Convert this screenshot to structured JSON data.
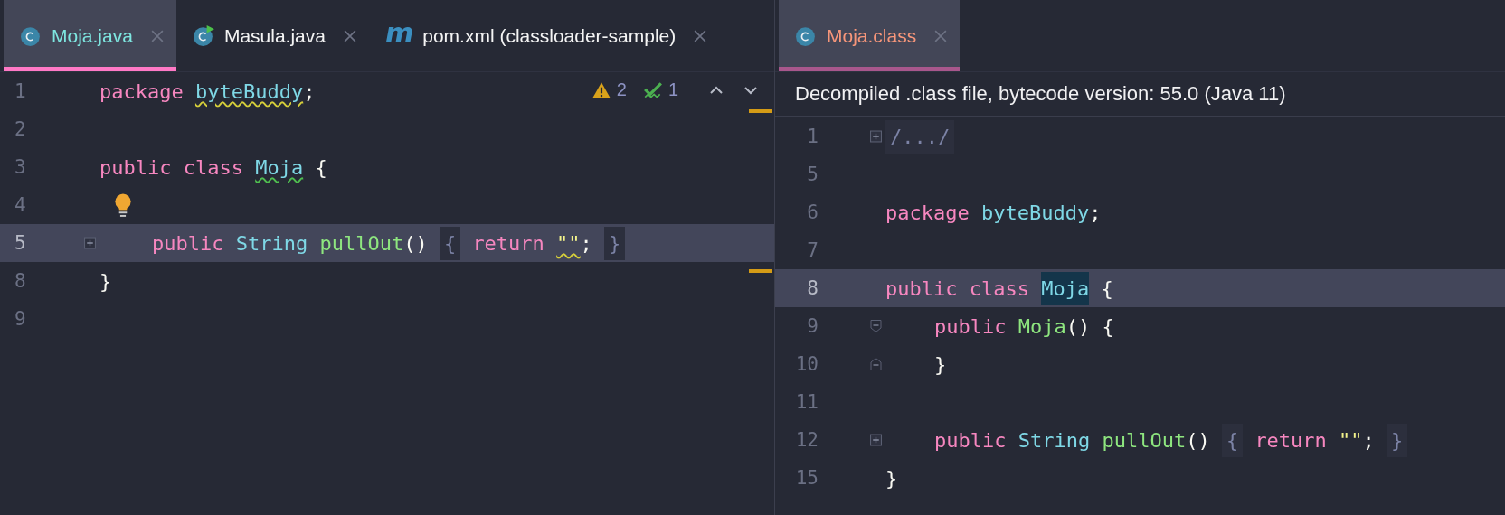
{
  "panes": [
    {
      "focused": true,
      "tabs": [
        {
          "label": "Moja.java",
          "kind": "class",
          "color": "#7ee6e0",
          "selected": true
        },
        {
          "label": "Masula.java",
          "kind": "runnable",
          "color": "#f4f4f4",
          "selected": false
        },
        {
          "label": "pom.xml (classloader-sample)",
          "kind": "maven",
          "icon_glyph": "m",
          "color": "#f4f4f4",
          "selected": false
        }
      ],
      "inspections": {
        "warnings": "2",
        "weak_warnings": "1"
      },
      "lines": [
        {
          "number": "1",
          "current": false,
          "kind": "plain",
          "bulb": false,
          "indented": false,
          "words": [
            [
              {
                "text": "package",
                "kind": "keyword"
              }
            ],
            [
              {
                "text": "byteBuddy",
                "kind": "type",
                "warning": true
              },
              {
                "text": ";",
                "kind": "plain"
              }
            ]
          ]
        },
        {
          "number": "2",
          "current": false,
          "kind": "plain",
          "bulb": false
        },
        {
          "number": "3",
          "current": false,
          "kind": "plain",
          "bulb": false,
          "indented": false,
          "words": [
            [
              {
                "text": "public",
                "kind": "keyword"
              }
            ],
            [
              {
                "text": "class",
                "kind": "keyword"
              }
            ],
            [
              {
                "text": "Moja",
                "kind": "type",
                "weak_warning": true
              }
            ],
            [
              {
                "text": "{",
                "kind": "plain"
              }
            ]
          ]
        },
        {
          "number": "4",
          "current": false,
          "kind": "plain",
          "bulb": true
        },
        {
          "number": "5",
          "current": true,
          "kind": "collapsed",
          "bulb": false,
          "indented": true,
          "words": [
            [
              {
                "text": "public",
                "kind": "keyword"
              }
            ],
            [
              {
                "text": "String",
                "kind": "type"
              }
            ],
            [
              {
                "text": "pullOut",
                "kind": "function"
              },
              {
                "text": "()",
                "kind": "plain"
              }
            ],
            [
              {
                "text": "{",
                "kind": "folded"
              }
            ],
            [
              {
                "text": "return",
                "kind": "keyword"
              }
            ],
            [
              {
                "text": "\"\"",
                "kind": "string",
                "warning": true
              },
              {
                "text": ";",
                "kind": "plain"
              }
            ],
            [
              {
                "text": "}",
                "kind": "folded"
              }
            ]
          ]
        },
        {
          "number": "8",
          "current": false,
          "kind": "plain",
          "bulb": false,
          "indented": false,
          "words": [
            [
              {
                "text": "}",
                "kind": "plain"
              }
            ]
          ]
        },
        {
          "number": "9",
          "current": false,
          "kind": "plain",
          "bulb": false
        }
      ]
    },
    {
      "focused": false,
      "tabs": [
        {
          "label": "Moja.class",
          "kind": "class",
          "color": "#f7967a",
          "selected": true
        }
      ],
      "banner": "Decompiled .class file, bytecode version: 55.0 (Java 11)",
      "lines": [
        {
          "number": "1",
          "current": false,
          "kind": "collapsed",
          "bulb": false,
          "indented": false,
          "words": [
            [
              {
                "text": "/.../",
                "kind": "folded"
              }
            ]
          ]
        },
        {
          "number": "5",
          "current": false,
          "kind": "plain",
          "bulb": false
        },
        {
          "number": "6",
          "current": false,
          "kind": "plain",
          "bulb": false,
          "indented": false,
          "words": [
            [
              {
                "text": "package",
                "kind": "keyword"
              }
            ],
            [
              {
                "text": "byteBuddy",
                "kind": "type"
              },
              {
                "text": ";",
                "kind": "plain"
              }
            ]
          ]
        },
        {
          "number": "7",
          "current": false,
          "kind": "plain",
          "bulb": false
        },
        {
          "number": "8",
          "current": true,
          "kind": "plain",
          "bulb": false,
          "indented": false,
          "words": [
            [
              {
                "text": "public",
                "kind": "keyword"
              }
            ],
            [
              {
                "text": "class",
                "kind": "keyword"
              }
            ],
            [
              {
                "text": "Moja",
                "kind": "type",
                "marked": true
              }
            ],
            [
              {
                "text": "{",
                "kind": "plain"
              }
            ]
          ]
        },
        {
          "number": "9",
          "current": false,
          "kind": "fold-start",
          "bulb": false,
          "indented": true,
          "words": [
            [
              {
                "text": "public",
                "kind": "keyword"
              }
            ],
            [
              {
                "text": "Moja",
                "kind": "function"
              },
              {
                "text": "()",
                "kind": "plain"
              }
            ],
            [
              {
                "text": "{",
                "kind": "plain"
              }
            ]
          ]
        },
        {
          "number": "10",
          "current": false,
          "kind": "fold-end",
          "bulb": false,
          "indented": true,
          "words": [
            [
              {
                "text": "}",
                "kind": "plain"
              }
            ]
          ]
        },
        {
          "number": "11",
          "current": false,
          "kind": "plain",
          "bulb": false
        },
        {
          "number": "12",
          "current": false,
          "kind": "collapsed",
          "bulb": false,
          "indented": true,
          "words": [
            [
              {
                "text": "public",
                "kind": "keyword"
              }
            ],
            [
              {
                "text": "String",
                "kind": "type"
              }
            ],
            [
              {
                "text": "pullOut",
                "kind": "function"
              },
              {
                "text": "()",
                "kind": "plain"
              }
            ],
            [
              {
                "text": "{",
                "kind": "folded"
              }
            ],
            [
              {
                "text": "return",
                "kind": "keyword"
              }
            ],
            [
              {
                "text": "\"\"",
                "kind": "string"
              },
              {
                "text": ";",
                "kind": "plain"
              }
            ],
            [
              {
                "text": "}",
                "kind": "folded"
              }
            ]
          ]
        },
        {
          "number": "15",
          "current": false,
          "kind": "plain",
          "bulb": false,
          "indented": false,
          "words": [
            [
              {
                "text": "}",
                "kind": "plain"
              }
            ]
          ]
        }
      ]
    }
  ]
}
